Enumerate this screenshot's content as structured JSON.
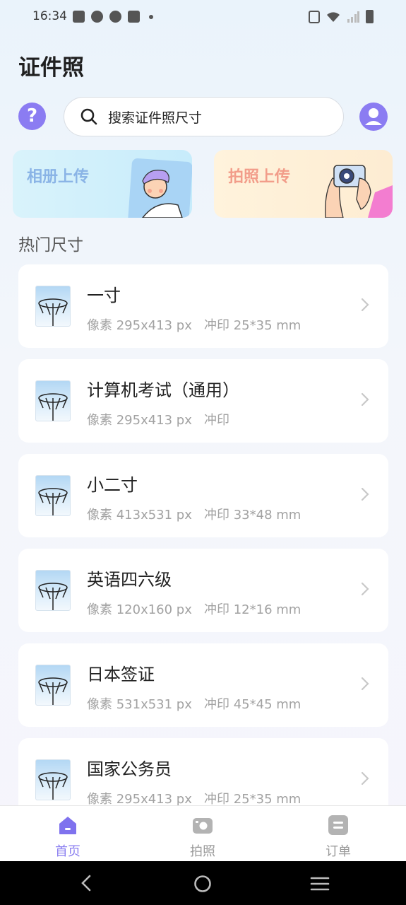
{
  "status_bar": {
    "time": "16:34"
  },
  "header": {
    "title": "证件照"
  },
  "search": {
    "placeholder": "搜索证件照尺寸"
  },
  "banners": {
    "album": "相册上传",
    "camera": "拍照上传"
  },
  "section": {
    "title": "热门尺寸"
  },
  "sizes": [
    {
      "name": "一寸",
      "pixels": "像素 295x413 px",
      "print": "冲印 25*35 mm"
    },
    {
      "name": "计算机考试（通用）",
      "pixels": "像素 295x413 px",
      "print": "冲印"
    },
    {
      "name": "小二寸",
      "pixels": "像素 413x531 px",
      "print": "冲印 33*48 mm"
    },
    {
      "name": "英语四六级",
      "pixels": "像素 120x160 px",
      "print": "冲印 12*16 mm"
    },
    {
      "name": "日本签证",
      "pixels": "像素 531x531 px",
      "print": "冲印 45*45 mm"
    },
    {
      "name": "国家公务员",
      "pixels": "像素 295x413 px",
      "print": "冲印 25*35 mm"
    }
  ],
  "bottom_nav": {
    "home": "首页",
    "photo": "拍照",
    "orders": "订单"
  },
  "colors": {
    "accent": "#8a7ef0",
    "muted": "#a2a2a2"
  }
}
